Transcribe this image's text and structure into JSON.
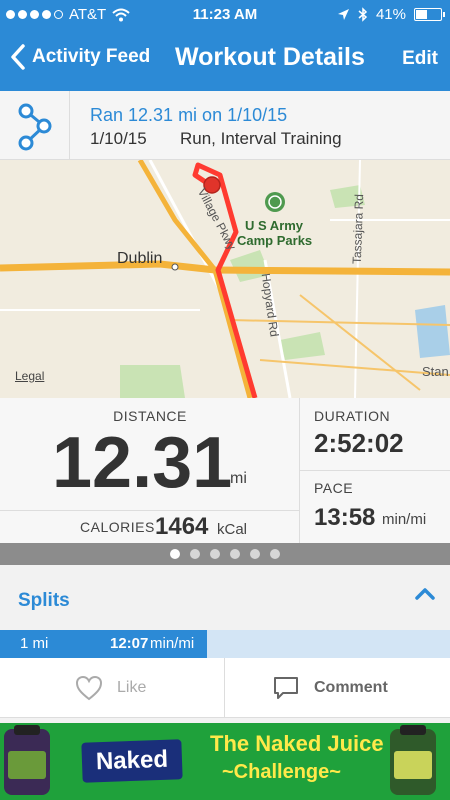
{
  "status_bar": {
    "carrier": "AT&T",
    "time": "11:23 AM",
    "battery": "41%",
    "signal_bars": 4
  },
  "nav": {
    "back_label": "Activity Feed",
    "title": "Workout Details",
    "edit_label": "Edit"
  },
  "summary": {
    "title": "Ran 12.31 mi on 1/10/15",
    "date": "1/10/15",
    "type": "Run, Interval Training",
    "icon": "route-icon"
  },
  "map": {
    "labels": {
      "dublin": "Dublin",
      "army": "U S Army",
      "camp": "Camp Parks",
      "village": "Village Pkwy",
      "hopyard": "Hopyard Rd",
      "tassajara": "Tassajara Rd",
      "stan": "Stan",
      "legal": "Legal"
    },
    "route_color": "#ff3b30"
  },
  "stats": {
    "distance_label": "DISTANCE",
    "distance_value": "12.31",
    "distance_unit": "mi",
    "calories_label": "CALORIES",
    "calories_value": "1464",
    "calories_unit": "kCal",
    "duration_label": "DURATION",
    "duration_value": "2:52:02",
    "pace_label": "PACE",
    "pace_value": "13:58",
    "pace_unit": "min/mi"
  },
  "pager": {
    "count": 6,
    "active": 0
  },
  "splits": {
    "header": "Splits",
    "rows": [
      {
        "distance": "1 mi",
        "pace": "12:07",
        "unit": "min/mi",
        "progress": 0.46
      }
    ]
  },
  "actions": {
    "like": "Like",
    "comment": "Comment"
  },
  "ad": {
    "brand": "Naked",
    "line1": "The Naked Juice",
    "line2": "~Challenge~"
  },
  "colors": {
    "accent": "#2c8ad6",
    "route": "#ff3b30",
    "ad_green": "#1fa13b"
  }
}
